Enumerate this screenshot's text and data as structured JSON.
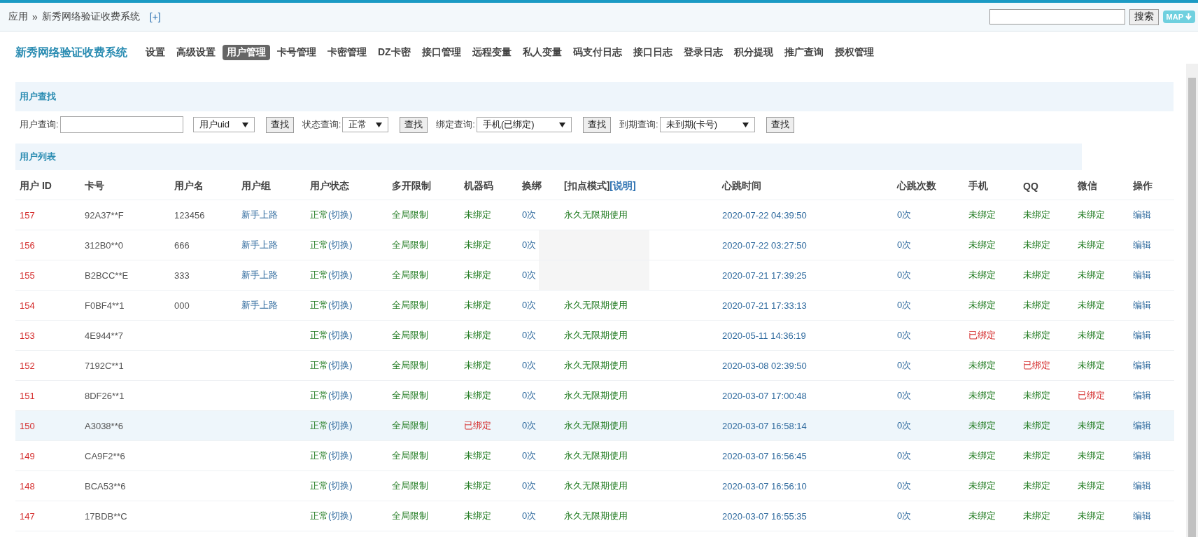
{
  "breadcrumb": {
    "root": "应用",
    "separator": "»",
    "current": "新秀网络验证收费系统",
    "add": "[+]"
  },
  "top_search": {
    "button": "搜索",
    "map": "MAP"
  },
  "brand": "新秀网络验证收费系统",
  "nav": [
    {
      "label": "设置",
      "selected": false
    },
    {
      "label": "高级设置",
      "selected": false
    },
    {
      "label": "用户管理",
      "selected": true
    },
    {
      "label": "卡号管理",
      "selected": false
    },
    {
      "label": "卡密管理",
      "selected": false
    },
    {
      "label": "DZ卡密",
      "selected": false
    },
    {
      "label": "接口管理",
      "selected": false
    },
    {
      "label": "远程变量",
      "selected": false
    },
    {
      "label": "私人变量",
      "selected": false
    },
    {
      "label": "码支付日志",
      "selected": false
    },
    {
      "label": "接口日志",
      "selected": false
    },
    {
      "label": "登录日志",
      "selected": false
    },
    {
      "label": "积分提现",
      "selected": false
    },
    {
      "label": "推广查询",
      "selected": false
    },
    {
      "label": "授权管理",
      "selected": false
    }
  ],
  "search_section": {
    "title": "用户查找",
    "filters": [
      {
        "kind": "input",
        "label": "用户查询:",
        "select": "用户uid",
        "button": "查找"
      },
      {
        "kind": "select",
        "label": "状态查询:",
        "select": "正常",
        "button": "查找"
      },
      {
        "kind": "select",
        "label": "绑定查询:",
        "select": "手机(已绑定)",
        "button": "查找"
      },
      {
        "kind": "select",
        "label": "到期查询:",
        "select": "未到期(卡号)",
        "button": "查找"
      }
    ]
  },
  "list_section": {
    "title": "用户列表"
  },
  "table": {
    "columns": [
      "用户 ID",
      "卡号",
      "用户名",
      "用户组",
      "用户状态",
      "多开限制",
      "机器码",
      "换绑",
      "[扣点模式]",
      "心跳时间",
      "心跳次数",
      "手机",
      "QQ",
      "微信",
      "操作"
    ],
    "mode_help": "[说明]",
    "rows": [
      {
        "id": "157",
        "card": "92A37**F",
        "name": "123456",
        "group": "新手上路",
        "status": "正常",
        "toggle": "(切换)",
        "limit": "全局限制",
        "machine": {
          "text": "未绑定",
          "bound": false
        },
        "rebind": "0次",
        "mode": "永久无限期使用",
        "heartbeat": "2020-07-22 04:39:50",
        "beats": "0次",
        "phone": {
          "text": "未绑定",
          "bound": false
        },
        "qq": {
          "text": "未绑定",
          "bound": false
        },
        "wechat": {
          "text": "未绑定",
          "bound": false
        },
        "action": "编辑",
        "selected": false
      },
      {
        "id": "156",
        "card": "312B0**0",
        "name": "666",
        "group": "新手上路",
        "status": "正常",
        "toggle": "(切换)",
        "limit": "全局限制",
        "machine": {
          "text": "未绑定",
          "bound": false
        },
        "rebind": "0次",
        "heartbeat": "2020-07-22 03:27:50",
        "beats": "0次",
        "phone": {
          "text": "未绑定",
          "bound": false
        },
        "qq": {
          "text": "未绑定",
          "bound": false
        },
        "wechat": {
          "text": "未绑定",
          "bound": false
        },
        "action": "编辑",
        "selected": false
      },
      {
        "id": "155",
        "card": "B2BCC**E",
        "name": "333",
        "group": "新手上路",
        "status": "正常",
        "toggle": "(切换)",
        "limit": "全局限制",
        "machine": {
          "text": "未绑定",
          "bound": false
        },
        "rebind": "0次",
        "heartbeat": "2020-07-21 17:39:25",
        "beats": "0次",
        "phone": {
          "text": "未绑定",
          "bound": false
        },
        "qq": {
          "text": "未绑定",
          "bound": false
        },
        "wechat": {
          "text": "未绑定",
          "bound": false
        },
        "action": "编辑",
        "selected": false
      },
      {
        "id": "154",
        "card": "F0BF4**1",
        "name": "000",
        "group": "新手上路",
        "status": "正常",
        "toggle": "(切换)",
        "limit": "全局限制",
        "machine": {
          "text": "未绑定",
          "bound": false
        },
        "rebind": "0次",
        "mode": "永久无限期使用",
        "heartbeat": "2020-07-21 17:33:13",
        "beats": "0次",
        "phone": {
          "text": "未绑定",
          "bound": false
        },
        "qq": {
          "text": "未绑定",
          "bound": false
        },
        "wechat": {
          "text": "未绑定",
          "bound": false
        },
        "action": "编辑",
        "selected": false
      },
      {
        "id": "153",
        "card": "4E944**7",
        "status": "正常",
        "toggle": "(切换)",
        "limit": "全局限制",
        "machine": {
          "text": "未绑定",
          "bound": false
        },
        "rebind": "0次",
        "mode": "永久无限期使用",
        "heartbeat": "2020-05-11 14:36:19",
        "beats": "0次",
        "phone": {
          "text": "已绑定",
          "bound": true
        },
        "qq": {
          "text": "未绑定",
          "bound": false
        },
        "wechat": {
          "text": "未绑定",
          "bound": false
        },
        "action": "编辑",
        "selected": false
      },
      {
        "id": "152",
        "card": "7192C**1",
        "status": "正常",
        "toggle": "(切换)",
        "limit": "全局限制",
        "machine": {
          "text": "未绑定",
          "bound": false
        },
        "rebind": "0次",
        "mode": "永久无限期使用",
        "heartbeat": "2020-03-08 02:39:50",
        "beats": "0次",
        "phone": {
          "text": "未绑定",
          "bound": false
        },
        "qq": {
          "text": "已绑定",
          "bound": true
        },
        "wechat": {
          "text": "未绑定",
          "bound": false
        },
        "action": "编辑",
        "selected": false
      },
      {
        "id": "151",
        "card": "8DF26**1",
        "status": "正常",
        "toggle": "(切换)",
        "limit": "全局限制",
        "machine": {
          "text": "未绑定",
          "bound": false
        },
        "rebind": "0次",
        "mode": "永久无限期使用",
        "heartbeat": "2020-03-07 17:00:48",
        "beats": "0次",
        "phone": {
          "text": "未绑定",
          "bound": false
        },
        "qq": {
          "text": "未绑定",
          "bound": false
        },
        "wechat": {
          "text": "已绑定",
          "bound": true
        },
        "action": "编辑",
        "selected": false
      },
      {
        "id": "150",
        "card": "A3038**6",
        "status": "正常",
        "toggle": "(切换)",
        "limit": "全局限制",
        "machine": {
          "text": "已绑定",
          "bound": true
        },
        "rebind": "0次",
        "mode": "永久无限期使用",
        "heartbeat": "2020-03-07 16:58:14",
        "beats": "0次",
        "phone": {
          "text": "未绑定",
          "bound": false
        },
        "qq": {
          "text": "未绑定",
          "bound": false
        },
        "wechat": {
          "text": "未绑定",
          "bound": false
        },
        "action": "编辑",
        "selected": true
      },
      {
        "id": "149",
        "card": "CA9F2**6",
        "status": "正常",
        "toggle": "(切换)",
        "limit": "全局限制",
        "machine": {
          "text": "未绑定",
          "bound": false
        },
        "rebind": "0次",
        "mode": "永久无限期使用",
        "heartbeat": "2020-03-07 16:56:45",
        "beats": "0次",
        "phone": {
          "text": "未绑定",
          "bound": false
        },
        "qq": {
          "text": "未绑定",
          "bound": false
        },
        "wechat": {
          "text": "未绑定",
          "bound": false
        },
        "action": "编辑",
        "selected": false
      },
      {
        "id": "148",
        "card": "BCA53**6",
        "status": "正常",
        "toggle": "(切换)",
        "limit": "全局限制",
        "machine": {
          "text": "未绑定",
          "bound": false
        },
        "rebind": "0次",
        "mode": "永久无限期使用",
        "heartbeat": "2020-03-07 16:56:10",
        "beats": "0次",
        "phone": {
          "text": "未绑定",
          "bound": false
        },
        "qq": {
          "text": "未绑定",
          "bound": false
        },
        "wechat": {
          "text": "未绑定",
          "bound": false
        },
        "action": "编辑",
        "selected": false
      },
      {
        "id": "147",
        "card": "17BDB**C",
        "status": "正常",
        "toggle": "(切换)",
        "limit": "全局限制",
        "machine": {
          "text": "未绑定",
          "bound": false
        },
        "rebind": "0次",
        "mode": "永久无限期使用",
        "heartbeat": "2020-03-07 16:55:35",
        "beats": "0次",
        "phone": {
          "text": "未绑定",
          "bound": false
        },
        "qq": {
          "text": "未绑定",
          "bound": false
        },
        "wechat": {
          "text": "未绑定",
          "bound": false
        },
        "action": "编辑",
        "selected": false
      }
    ]
  }
}
